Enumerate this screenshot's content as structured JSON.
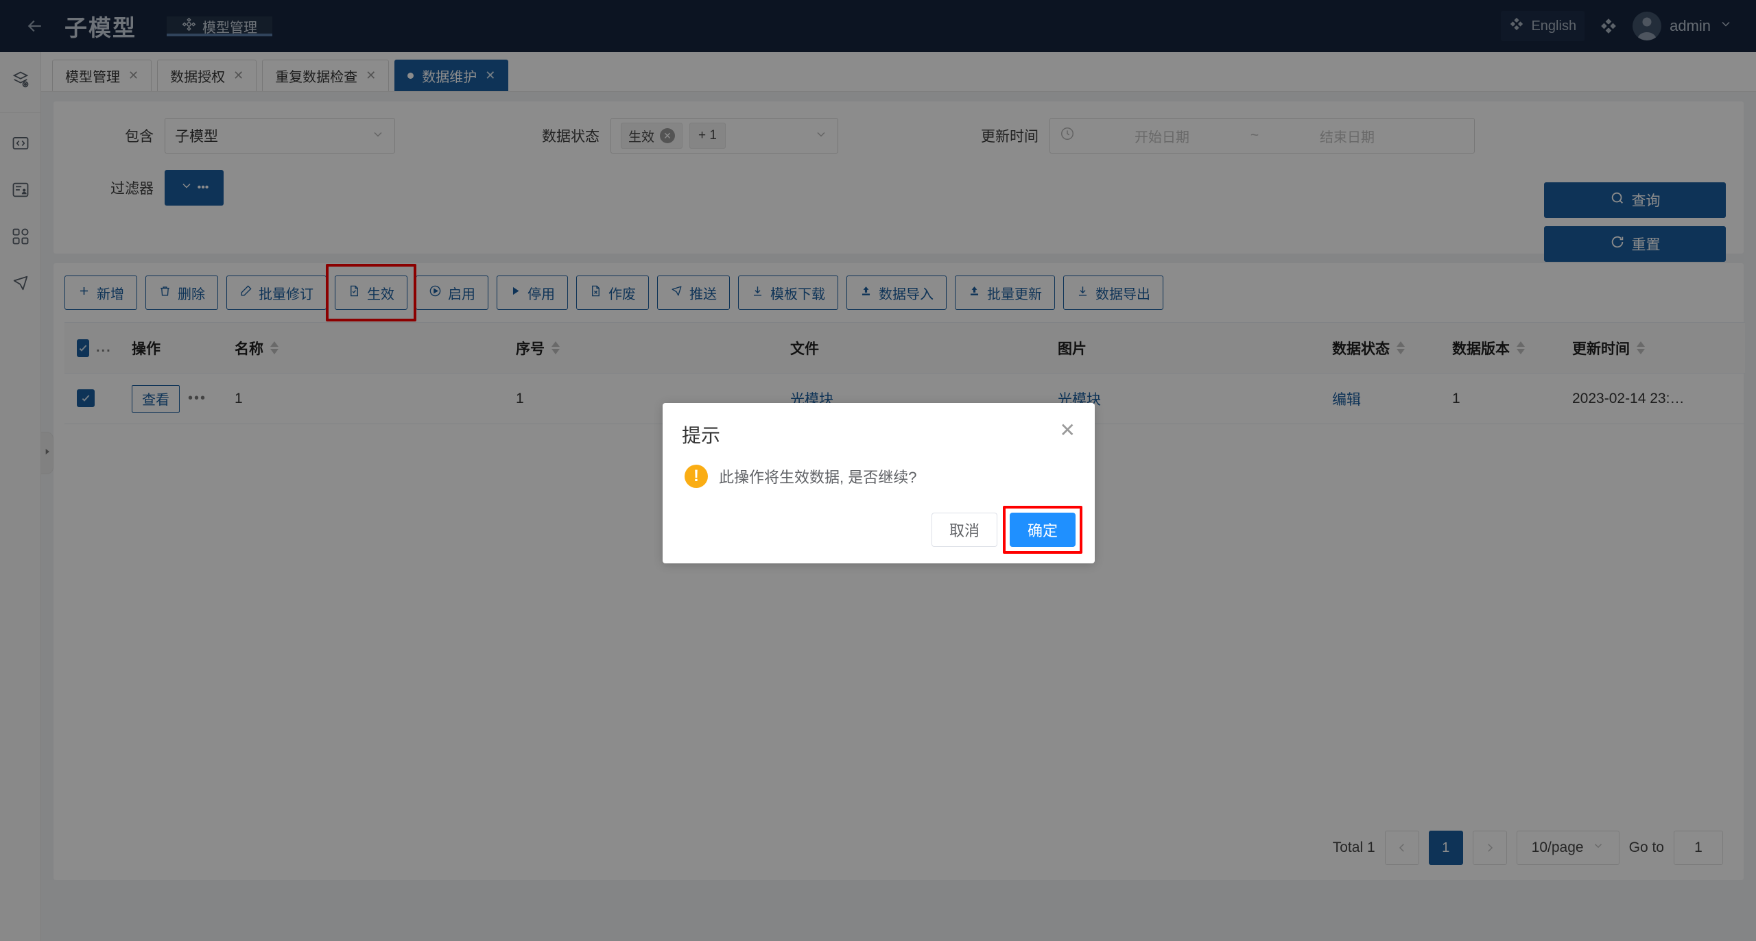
{
  "header": {
    "back_icon": "arrow-left-icon",
    "app_title": "子模型",
    "nav": [
      {
        "label": "模型管理",
        "icon": "model-gear-icon",
        "active": true
      }
    ],
    "language_label": "English",
    "language_icon": "globe-icon",
    "theme_icon": "theme-icon",
    "user_name": "admin",
    "user_caret": "chevron-down-icon"
  },
  "rail": {
    "items": [
      {
        "name": "sidebar-item-model",
        "icon": "layers-icon"
      },
      {
        "name": "sidebar-item-code",
        "icon": "code-icon"
      },
      {
        "name": "sidebar-item-authorization",
        "icon": "document-user-icon"
      },
      {
        "name": "sidebar-item-apps",
        "icon": "grid-apps-icon"
      },
      {
        "name": "sidebar-item-send",
        "icon": "send-icon"
      }
    ],
    "collapse_icon": "chevron-right-icon"
  },
  "tabs": [
    {
      "label": "模型管理",
      "active": false
    },
    {
      "label": "数据授权",
      "active": false
    },
    {
      "label": "重复数据检查",
      "active": false
    },
    {
      "label": "数据维护",
      "active": true
    }
  ],
  "filters": {
    "include": {
      "label": "包含",
      "value": "子模型",
      "caret": "chevron-down-icon"
    },
    "status": {
      "label": "数据状态",
      "tags": [
        "生效"
      ],
      "more": "+ 1",
      "caret": "chevron-down-icon"
    },
    "update_time": {
      "label": "更新时间",
      "icon": "clock-icon",
      "start_placeholder": "开始日期",
      "separator": "~",
      "end_placeholder": "结束日期"
    },
    "filter_builder": {
      "label": "过滤器",
      "caret": "chevron-down-icon",
      "dots": "•••"
    },
    "search_button": {
      "label": "查询",
      "icon": "search-icon"
    },
    "reset_button": {
      "label": "重置",
      "icon": "refresh-icon"
    }
  },
  "toolbar": [
    {
      "label": "新增",
      "icon": "plus-icon",
      "highlighted": false
    },
    {
      "label": "删除",
      "icon": "trash-icon",
      "highlighted": false
    },
    {
      "label": "批量修订",
      "icon": "pen-icon",
      "highlighted": false
    },
    {
      "label": "生效",
      "icon": "file-check-icon",
      "highlighted": true
    },
    {
      "label": "启用",
      "icon": "play-circle-icon",
      "highlighted": false
    },
    {
      "label": "停用",
      "icon": "triangle-right-icon",
      "highlighted": false
    },
    {
      "label": "作废",
      "icon": "file-x-icon",
      "highlighted": false
    },
    {
      "label": "推送",
      "icon": "send-icon",
      "highlighted": false
    },
    {
      "label": "模板下载",
      "icon": "download-icon",
      "highlighted": false
    },
    {
      "label": "数据导入",
      "icon": "cloud-upload-icon",
      "highlighted": false
    },
    {
      "label": "批量更新",
      "icon": "cloud-upload-icon",
      "highlighted": false
    },
    {
      "label": "数据导出",
      "icon": "download-icon",
      "highlighted": false
    }
  ],
  "table": {
    "columns": [
      {
        "key": "select",
        "label": "",
        "sortable": false,
        "header_more": "..."
      },
      {
        "key": "action",
        "label": "操作",
        "sortable": false
      },
      {
        "key": "name",
        "label": "名称",
        "sortable": true
      },
      {
        "key": "seq",
        "label": "序号",
        "sortable": true
      },
      {
        "key": "file",
        "label": "文件",
        "sortable": false
      },
      {
        "key": "image",
        "label": "图片",
        "sortable": false
      },
      {
        "key": "status",
        "label": "数据状态",
        "sortable": true
      },
      {
        "key": "version",
        "label": "数据版本",
        "sortable": true
      },
      {
        "key": "updated",
        "label": "更新时间",
        "sortable": true
      }
    ],
    "rows": [
      {
        "selected": true,
        "action_label": "查看",
        "action_more": "•••",
        "name": "1",
        "seq": "1",
        "file": "光模块",
        "image": "光模块",
        "status": "编辑",
        "version": "1",
        "updated": "2023-02-14 23:…"
      }
    ]
  },
  "pagination": {
    "total_label": "Total 1",
    "prev_icon": "chevron-left-icon",
    "next_icon": "chevron-right-icon",
    "pages": [
      "1"
    ],
    "current_page": "1",
    "page_size_label": "10/page",
    "page_size_caret": "chevron-down-icon",
    "goto_label": "Go to",
    "goto_value": "1"
  },
  "dialog": {
    "title": "提示",
    "close_icon": "close-icon",
    "warning_icon": "warning-icon",
    "message": "此操作将生效数据, 是否继续?",
    "cancel_label": "取消",
    "confirm_label": "确定"
  },
  "colors": {
    "header_bg": "#16263f",
    "primary": "#1a5e9e",
    "confirm_blue": "#1f90ff",
    "highlight_red": "#fe0000",
    "warning_orange": "#faad14"
  }
}
